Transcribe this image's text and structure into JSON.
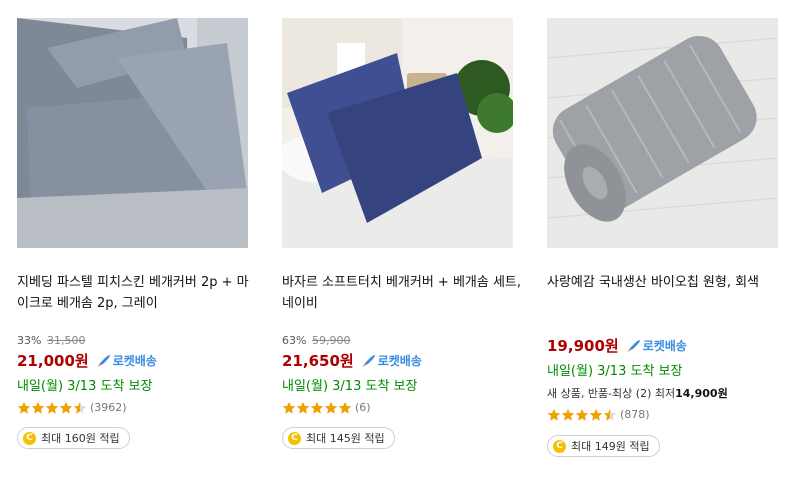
{
  "products": [
    {
      "image_desc": "gray linen cushion covers",
      "title": "지베딩 파스텔 피치스킨 베개커버 2p + 마이크로 베개솜 2p, 그레이",
      "discount": "33%",
      "original_price": "31,500",
      "price": "21,000원",
      "rocket": "로켓배송",
      "delivery": "내일(월) 3/13 도착 보장",
      "rating": 4.5,
      "review_count": "(3962)",
      "points": "최대 160원 적립"
    },
    {
      "image_desc": "navy pillowcases on bed",
      "title": "바자르 소프트터치 베개커버 + 베개솜 세트, 네이비",
      "discount": "63%",
      "original_price": "59,900",
      "price": "21,650원",
      "rocket": "로켓배송",
      "delivery": "내일(월) 3/13 도착 보장",
      "rating": 5,
      "review_count": "(6)",
      "points": "최대 145원 적립"
    },
    {
      "image_desc": "gray round bolster pillow",
      "title": "사랑예감 국내생산 바이오칩 원형, 회색",
      "price": "19,900원",
      "rocket": "로켓배송",
      "delivery": "내일(월) 3/13 도착 보장",
      "extra_prefix": "새 상품, 반품-최상 (2) 최저",
      "extra_price": "14,900원",
      "rating": 4.5,
      "review_count": "(878)",
      "points": "최대 149원 적립"
    }
  ],
  "icons": {
    "rocket": "rocket-icon",
    "coin": "coin-icon",
    "star": "star-icon"
  },
  "colors": {
    "price": "#ae0000",
    "delivery": "#008c00",
    "rocket": "#3a8de0",
    "star": "#f0a000",
    "coin": "#f5c000"
  }
}
